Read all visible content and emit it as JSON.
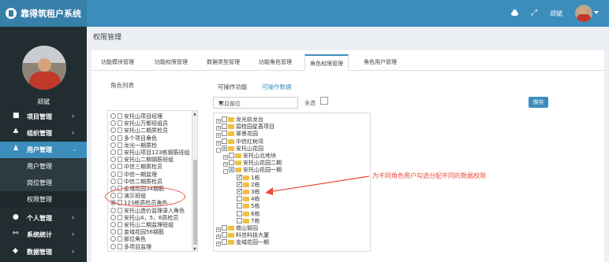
{
  "app": {
    "title": "靠得筑租户系统",
    "user_name": "郑斌",
    "user_menu": "郑斌"
  },
  "sidebar": {
    "user_name": "郑斌",
    "items": [
      {
        "label": "项目管理",
        "icon": "briefcase-icon"
      },
      {
        "label": "组织管理",
        "icon": "sitemap-icon"
      },
      {
        "label": "用户管理",
        "icon": "users-icon"
      },
      {
        "label": "个人管理",
        "icon": "user-icon"
      },
      {
        "label": "系统统计",
        "icon": "share-icon"
      },
      {
        "label": "数据管理",
        "icon": "database-icon"
      }
    ],
    "subitems": [
      {
        "label": "用户管理"
      },
      {
        "label": "岗位管理"
      },
      {
        "label": "权限管理"
      }
    ]
  },
  "page": {
    "title": "权限管理"
  },
  "tabs": [
    "功能模块管理",
    "功能权限管理",
    "数据类型管理",
    "功能角色管理",
    "角色权限管理",
    "角色用户管理"
  ],
  "roles": {
    "title": "角色列表",
    "items": [
      "安托山项目经理",
      "安托山万都班组员",
      "安托山二期质检员",
      "多个项目角色",
      "龙光一期质检",
      "安托山项目123栋钢筋班组",
      "安托山二期钢筋班组",
      "中信三期质检员",
      "中信一期监理",
      "中信二期质检员",
      "金域花园34钢筋",
      "演示班组",
      "123栋质检员角色",
      "安托山造价监理录入角色",
      "安托山4，5，6质检员",
      "安托山二期监理班组",
      "金域花园56钢筋",
      "部位角色",
      "多项目监理"
    ]
  },
  "data_panel": {
    "subtabs": [
      "可操作功能",
      "可操作数据"
    ],
    "select_value": "项目部位",
    "select_all_label": "全选",
    "save_label": "保存",
    "tree": [
      "龙光玖龙台",
      "碧桂园星荟项目",
      "翠景花园",
      "中信红树湾",
      "安托山花园",
      "安托山北地块",
      "安托山花园二期",
      "安托山花园一期",
      "1栋",
      "2栋",
      "3栋",
      "4栋",
      "5栋",
      "6栋",
      "7栋",
      "南山智园",
      "科信科技大厦",
      "金域花园一期"
    ],
    "annotation": "为不同角色用户勾选分配不同的数据权限"
  },
  "colors": {
    "primary": "#3c8dbc",
    "sidebar": "#222d32",
    "annotation": "#e74c3c"
  }
}
